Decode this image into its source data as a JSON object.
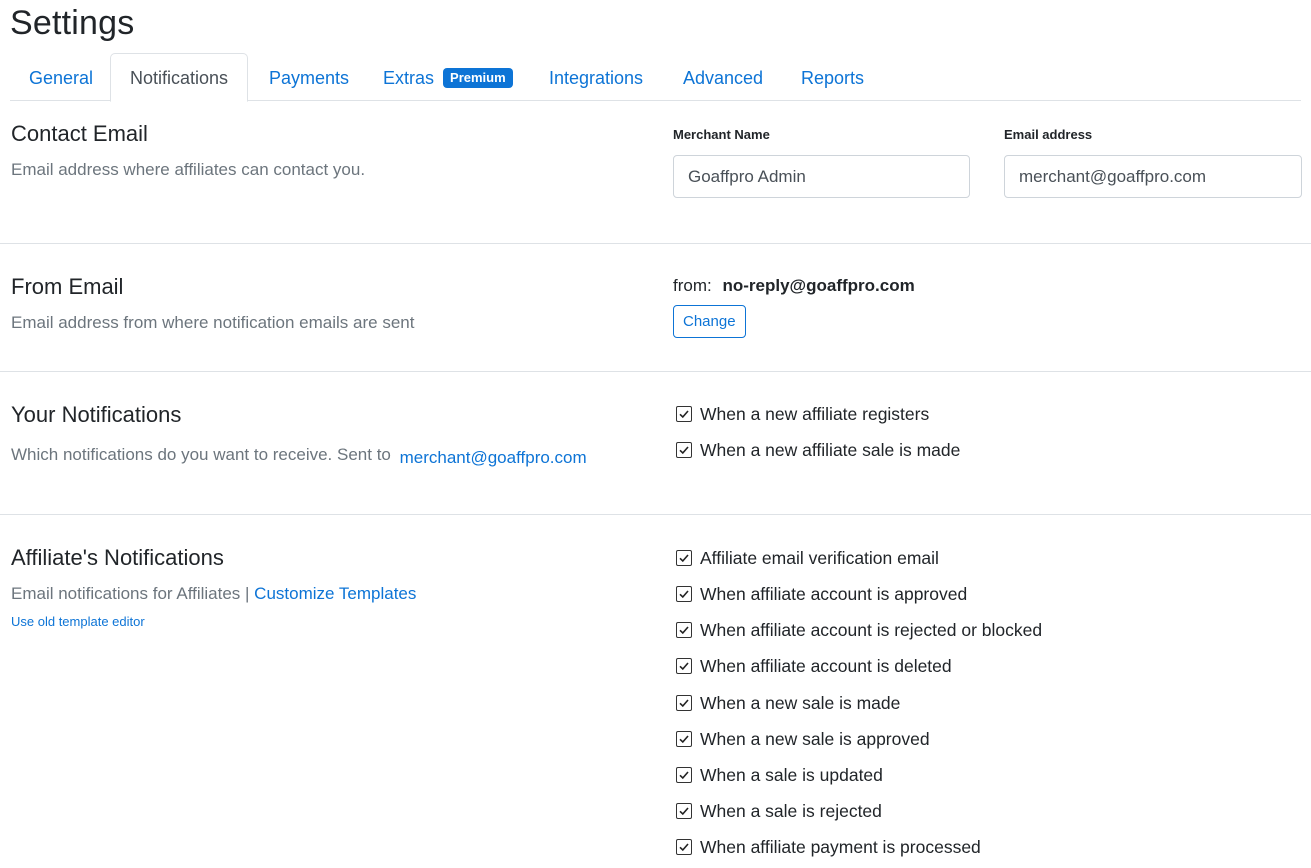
{
  "page": {
    "title": "Settings"
  },
  "tabs": [
    {
      "label": "General"
    },
    {
      "label": "Notifications"
    },
    {
      "label": "Payments"
    },
    {
      "label": "Extras",
      "badge": "Premium"
    },
    {
      "label": "Integrations"
    },
    {
      "label": "Advanced"
    },
    {
      "label": "Reports"
    }
  ],
  "active_tab": "Notifications",
  "contact_email": {
    "title": "Contact Email",
    "description": "Email address where affiliates can contact you.",
    "merchant_name_label": "Merchant Name",
    "merchant_name_value": "Goaffpro Admin",
    "email_label": "Email address",
    "email_value": "merchant@goaffpro.com"
  },
  "from_email": {
    "title": "From Email",
    "description": "Email address from where notification emails are sent",
    "from_prefix": "from:",
    "from_value": "no-reply@goaffpro.com",
    "change_label": "Change"
  },
  "your_notifications": {
    "title": "Your Notifications",
    "description": "Which notifications do you want to receive. Sent to",
    "email_link": "merchant@goaffpro.com",
    "options": [
      {
        "label": "When a new affiliate registers",
        "checked": true
      },
      {
        "label": "When a new affiliate sale is made",
        "checked": true
      }
    ]
  },
  "affiliate_notifications": {
    "title": "Affiliate's Notifications",
    "description": "Email notifications for Affiliates |",
    "customize_link": "Customize Templates",
    "old_editor_link": "Use old template editor",
    "options": [
      {
        "label": "Affiliate email verification email",
        "checked": true
      },
      {
        "label": "When affiliate account is approved",
        "checked": true
      },
      {
        "label": "When affiliate account is rejected or blocked",
        "checked": true
      },
      {
        "label": "When affiliate account is deleted",
        "checked": true
      },
      {
        "label": "When a new sale is made",
        "checked": true
      },
      {
        "label": "When a new sale is approved",
        "checked": true
      },
      {
        "label": "When a sale is updated",
        "checked": true
      },
      {
        "label": "When a sale is rejected",
        "checked": true
      },
      {
        "label": "When affiliate payment is processed",
        "checked": true
      }
    ]
  },
  "colors": {
    "link": "#0d74d6",
    "muted": "#6c757d",
    "border": "#dee2e6"
  },
  "icons": {
    "checkbox": "checkmark-icon"
  }
}
